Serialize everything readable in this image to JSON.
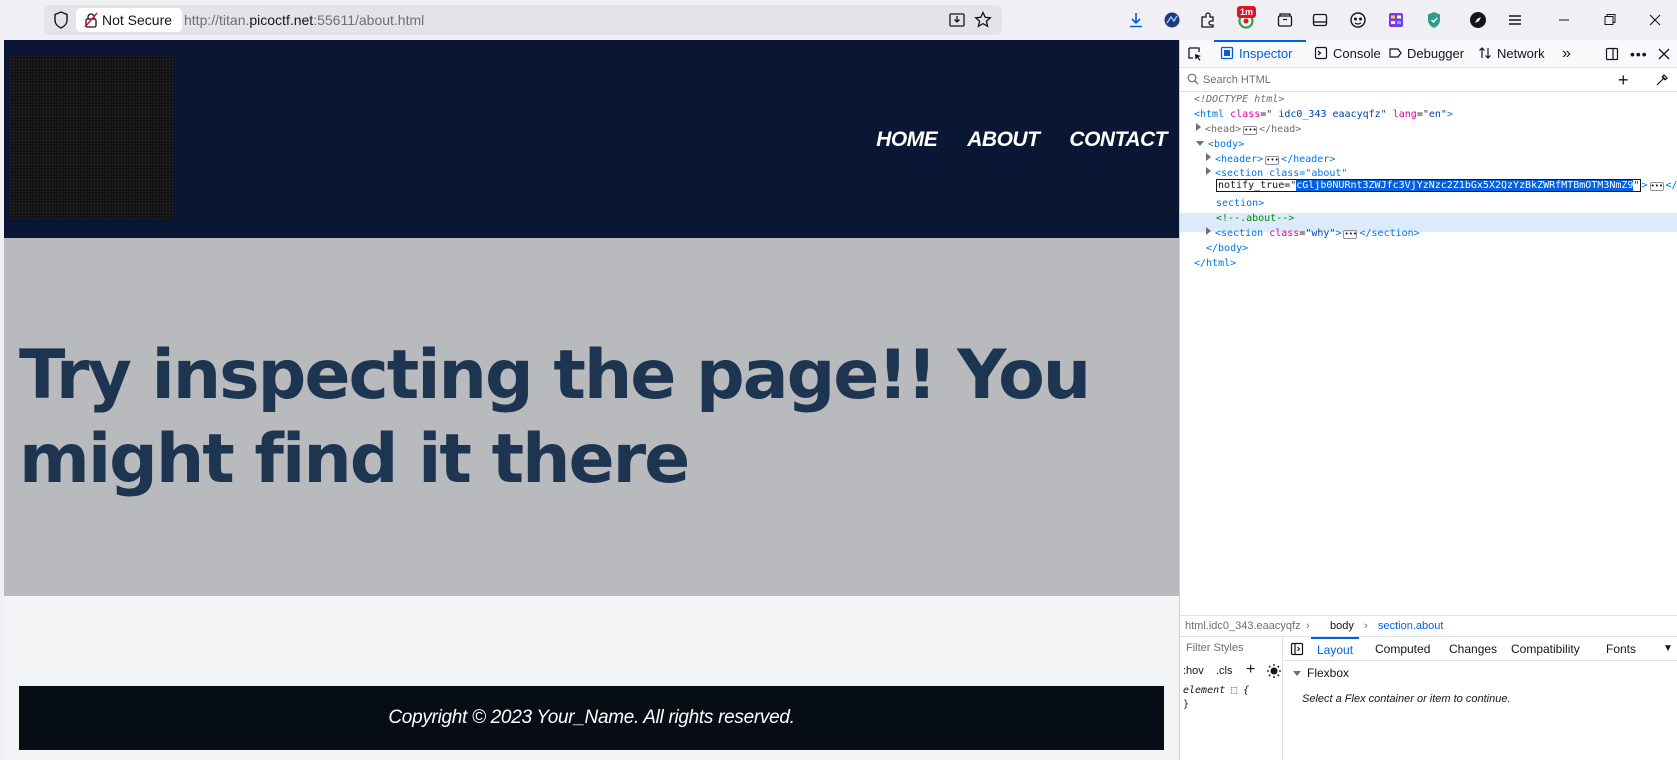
{
  "browser": {
    "security_label": "Not Secure",
    "url_prefix": "http://titan.",
    "url_domain": "picoctf.net",
    "url_suffix": ":55611/about.html",
    "extension_badge": "1m"
  },
  "site": {
    "nav": [
      "HOME",
      "ABOUT",
      "CONTACT"
    ],
    "hero_text": "Try inspecting the page!! You might find it there",
    "footer_text": "Copyright © 2023 Your_Name. All rights reserved."
  },
  "devtools": {
    "tabs": {
      "inspector": "Inspector",
      "console": "Console",
      "debugger": "Debugger",
      "network": "Network"
    },
    "search_placeholder": "Search HTML",
    "tree": {
      "doctype": "<!DOCTYPE html>",
      "html_open": "<html",
      "html_class_attr": "class",
      "html_class_val": "\" idc0_343 eaacyqfz\"",
      "html_lang_attr": "lang",
      "html_lang_val": "\"en\"",
      "gt": ">",
      "head_open": "<head>",
      "head_close": "</head>",
      "body_open": "<body>",
      "header_open": "<header>",
      "header_close": "</header>",
      "section_about_open": "<section class=\"about\"",
      "notify_attr": "notify_true=",
      "quote": "\"",
      "notify_val": "cGljb0NURnt3ZWJfc3VjYzNzc2Z1bGx5X2QzYzBkZWRfMTBmOTM3NmZ9",
      "tail": ">",
      "section_close_tail": "</",
      "section_word": "section>",
      "comment": "<!--.about-->",
      "section_why_open": "<section",
      "section_why_class_attr": "class",
      "section_why_class_val": "\"why\"",
      "section_why_close": "</section>",
      "body_close": "</body>",
      "html_close": "</html>"
    },
    "breadcrumbs": [
      "html.idc0_343.eaacyqfz",
      "body",
      "section.about"
    ],
    "rules": {
      "filter_placeholder": "Filter Styles",
      "hov": ":hov",
      "cls": ".cls",
      "element_rule": "element ⬚ {",
      "close_brace": "}"
    },
    "sidebar_tabs": [
      "Layout",
      "Computed",
      "Changes",
      "Compatibility",
      "Fonts"
    ],
    "flexbox_title": "Flexbox",
    "flexbox_message": "Select a Flex container or item to continue."
  },
  "colors": {
    "header_bg": "#0b1635",
    "hero_bg": "#b8babe",
    "hero_text": "#1d3550",
    "footer_bg": "#070d15",
    "devtools_accent": "#0060df"
  }
}
